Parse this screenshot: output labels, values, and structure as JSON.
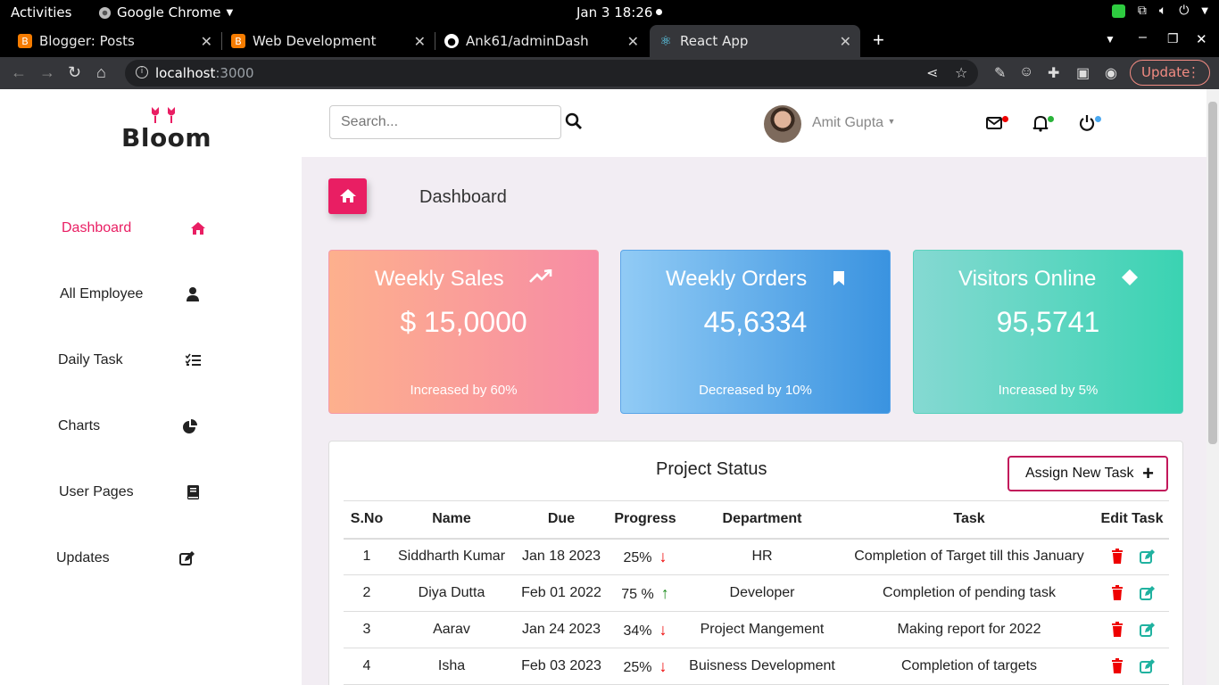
{
  "system": {
    "activities": "Activities",
    "app_name": "Google Chrome",
    "clock": "Jan 3  18:26"
  },
  "tabs": [
    {
      "label": "Blogger: Posts",
      "icon": "blogger-icon",
      "color": "#f57c00"
    },
    {
      "label": "Web Development",
      "icon": "blogger-icon",
      "color": "#f57c00"
    },
    {
      "label": "Ank61/adminDash",
      "icon": "github-icon",
      "color": "#ffffff"
    },
    {
      "label": "React App",
      "icon": "react-icon",
      "color": "#61dafb"
    }
  ],
  "browser": {
    "url_host": "localhost",
    "url_port": ":3000",
    "update_label": "Update"
  },
  "brand": {
    "name": "Bloom",
    "accent": "#e91e63"
  },
  "sidebar": {
    "items": [
      {
        "label": "Dashboard",
        "icon": "home-icon",
        "active": true
      },
      {
        "label": "All Employee",
        "icon": "user-icon"
      },
      {
        "label": "Daily Task",
        "icon": "tasks-icon"
      },
      {
        "label": "Charts",
        "icon": "pie-chart-icon"
      },
      {
        "label": "User Pages",
        "icon": "book-icon"
      },
      {
        "label": "Updates",
        "icon": "edit-icon"
      }
    ]
  },
  "header": {
    "search_placeholder": "Search...",
    "user_name": "Amit Gupta"
  },
  "main": {
    "title": "Dashboard",
    "cards": [
      {
        "title": "Weekly Sales",
        "value": "$ 15,0000",
        "sub": "Increased by 60%",
        "icon": "trending-up-icon"
      },
      {
        "title": "Weekly Orders",
        "value": "45,6334",
        "sub": "Decreased by 10%",
        "icon": "bookmark-icon"
      },
      {
        "title": "Visitors Online",
        "value": "95,5741",
        "sub": "Increased by 5%",
        "icon": "diamond-icon"
      }
    ],
    "project": {
      "title": "Project Status",
      "assign_label": "Assign New Task",
      "columns": [
        "S.No",
        "Name",
        "Due",
        "Progress",
        "Department",
        "Task",
        "Edit Task"
      ],
      "rows": [
        {
          "sno": "1",
          "name": "Siddharth Kumar",
          "due": "Jan 18 2023",
          "progress": "25%",
          "trend": "down",
          "dept": "HR",
          "task": "Completion of Target till this January"
        },
        {
          "sno": "2",
          "name": "Diya Dutta",
          "due": "Feb 01 2022",
          "progress": "75 %",
          "trend": "up",
          "dept": "Developer",
          "task": "Completion of pending task"
        },
        {
          "sno": "3",
          "name": "Aarav",
          "due": "Jan 24 2023",
          "progress": "34%",
          "trend": "down",
          "dept": "Project Mangement",
          "task": "Making report for 2022"
        },
        {
          "sno": "4",
          "name": "Isha",
          "due": "Feb 03 2023",
          "progress": "25%",
          "trend": "down",
          "dept": "Buisness Development",
          "task": "Completion of targets"
        }
      ]
    }
  }
}
